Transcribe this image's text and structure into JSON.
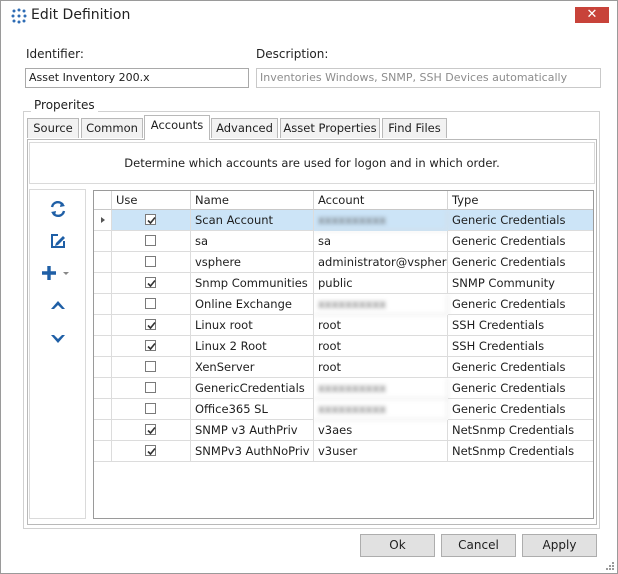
{
  "window": {
    "title": "Edit Definition",
    "close_icon": "close-icon"
  },
  "identifier": {
    "label": "Identifier:",
    "value": "Asset Inventory 200.x"
  },
  "description": {
    "label": "Description:",
    "placeholder": "Inventories Windows, SNMP, SSH Devices automatically"
  },
  "group_label": "Properites",
  "tabs": [
    "Source",
    "Common",
    "Accounts",
    "Advanced",
    "Asset Properties",
    "Find Files"
  ],
  "active_tab": "Accounts",
  "info_text": "Determine which accounts are used for logon and in which order.",
  "toolbar": [
    "refresh-icon",
    "edit-icon",
    "add-icon",
    "move-up-icon",
    "move-down-icon"
  ],
  "columns": [
    "Use",
    "Name",
    "Account",
    "Type"
  ],
  "rows": [
    {
      "use": true,
      "name": "Scan Account",
      "account": "(blurred)",
      "type": "Generic Credentials"
    },
    {
      "use": false,
      "name": "sa",
      "account": "sa",
      "type": "Generic Credentials"
    },
    {
      "use": false,
      "name": "vsphere",
      "account": "administrator@vsphere....",
      "type": "Generic Credentials"
    },
    {
      "use": true,
      "name": "Snmp Communities",
      "account": "public",
      "type": "SNMP Community"
    },
    {
      "use": false,
      "name": "Online Exchange",
      "account": "(blurred)",
      "type": "Generic Credentials"
    },
    {
      "use": true,
      "name": "Linux root",
      "account": "root",
      "type": "SSH Credentials"
    },
    {
      "use": true,
      "name": "Linux 2 Root",
      "account": "root",
      "type": "SSH Credentials"
    },
    {
      "use": false,
      "name": "XenServer",
      "account": "root",
      "type": "Generic Credentials"
    },
    {
      "use": false,
      "name": "GenericCredentials",
      "account": "(blurred)",
      "type": "Generic Credentials"
    },
    {
      "use": false,
      "name": "Office365 SL",
      "account": "(blurred)",
      "type": "Generic Credentials"
    },
    {
      "use": true,
      "name": "SNMP v3 AuthPriv",
      "account": "v3aes",
      "type": "NetSnmp Credentials"
    },
    {
      "use": true,
      "name": "SNMPv3 AuthNoPriv",
      "account": "v3user",
      "type": "NetSnmp Credentials"
    }
  ],
  "selected_row": 0,
  "buttons": {
    "ok": "Ok",
    "cancel": "Cancel",
    "apply": "Apply"
  },
  "colors": {
    "selection": "#cce4f7",
    "icon_blue": "#1f5fa6",
    "close_red": "#c8433a"
  }
}
